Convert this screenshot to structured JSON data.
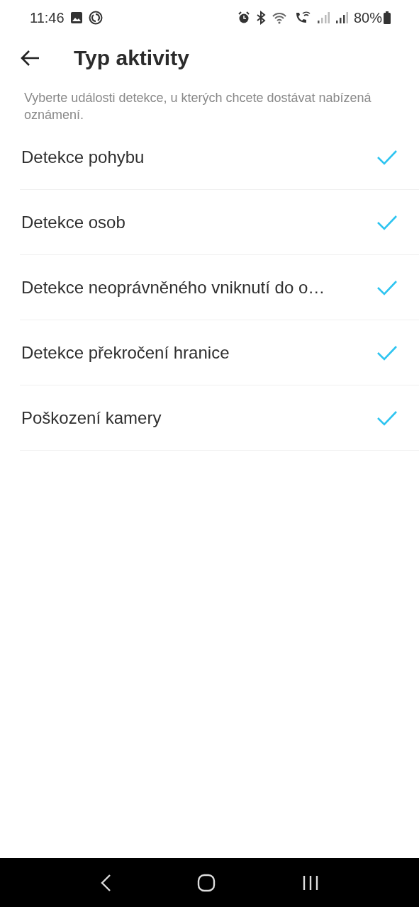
{
  "status_bar": {
    "time": "11:46",
    "battery": "80%"
  },
  "header": {
    "title": "Typ aktivity"
  },
  "description": "Vyberte události detekce, u kterých chcete dostávat nabízená oznámení.",
  "items": [
    {
      "label": "Detekce pohybu",
      "checked": true
    },
    {
      "label": "Detekce osob",
      "checked": true
    },
    {
      "label": "Detekce neoprávněného vniknutí do o…",
      "checked": true
    },
    {
      "label": "Detekce překročení hranice",
      "checked": true
    },
    {
      "label": "Poškození kamery",
      "checked": true
    }
  ]
}
